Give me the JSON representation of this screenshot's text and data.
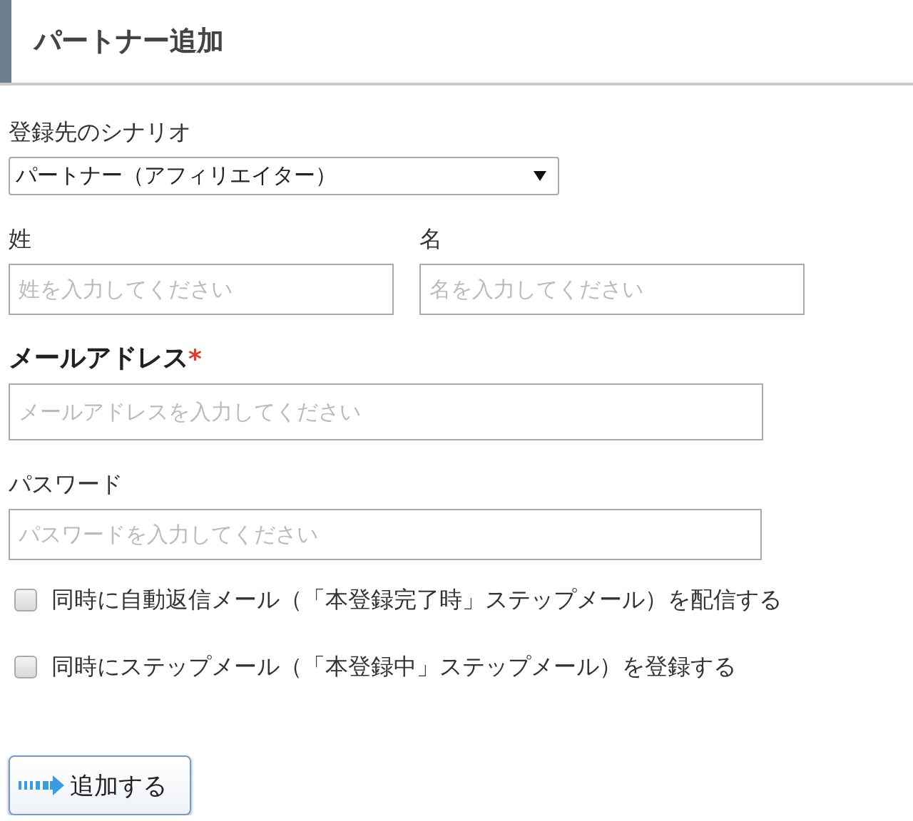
{
  "header": {
    "title": "パートナー追加"
  },
  "scenario": {
    "label": "登録先のシナリオ",
    "value": "パートナー（アフィリエイター）"
  },
  "name_fields": [
    {
      "kind": "plain",
      "label": "姓",
      "placeholder": "姓を入力してください"
    },
    {
      "kind": "plain",
      "label": "名",
      "placeholder": "名を入力してください"
    }
  ],
  "email": {
    "kind": "emphasized",
    "label": "メールアドレス",
    "required_mark": "*",
    "placeholder": "メールアドレスを入力してください"
  },
  "password": {
    "kind": "plain",
    "label": "パスワード",
    "placeholder": "パスワードを入力してください"
  },
  "options": [
    {
      "label": "同時に自動返信メール（「本登録完了時」ステップメール）を配信する",
      "checked": false
    },
    {
      "label": "同時にステップメール（「本登録中」ステップメール）を登録する",
      "checked": false
    }
  ],
  "submit_button": {
    "label": "追加する"
  }
}
